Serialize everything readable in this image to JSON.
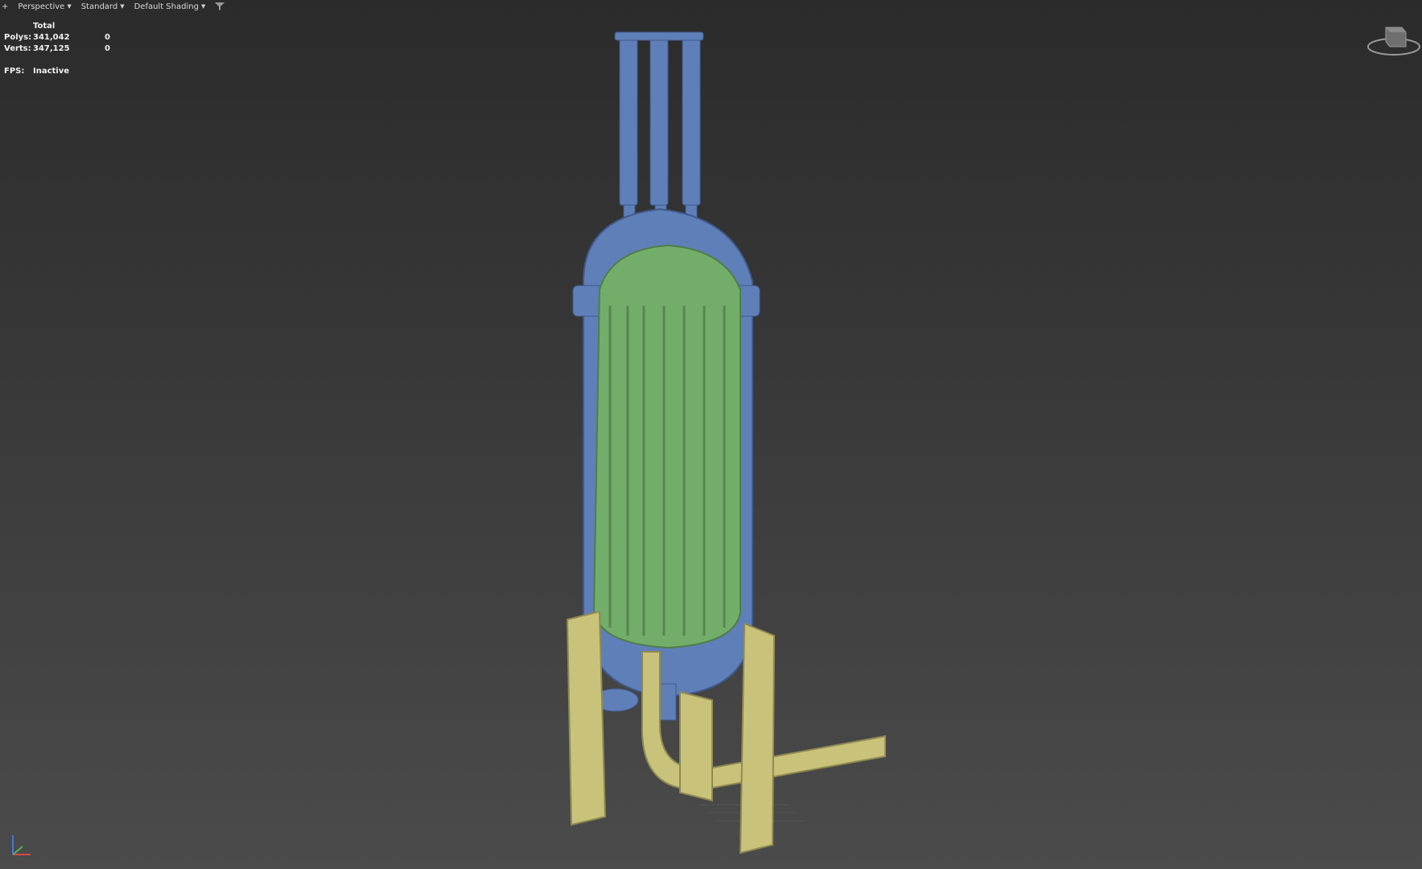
{
  "viewport": {
    "menu_plus": "+",
    "view_label": "Perspective",
    "mode_label": "Standard",
    "shading_label": "Default Shading"
  },
  "stats": {
    "header": "Total",
    "polys_label": "Polys:",
    "polys_total": "341,042",
    "polys_selected": "0",
    "verts_label": "Verts:",
    "verts_total": "347,125",
    "verts_selected": "0",
    "fps_label": "FPS:",
    "fps_value": "Inactive"
  },
  "colors": {
    "background_top": "#2b2b2b",
    "background_bottom": "#4b4b4b",
    "vessel_blue": "#5f7fb9",
    "vessel_green": "#73ad6a",
    "support_yellow": "#c9c27a"
  }
}
